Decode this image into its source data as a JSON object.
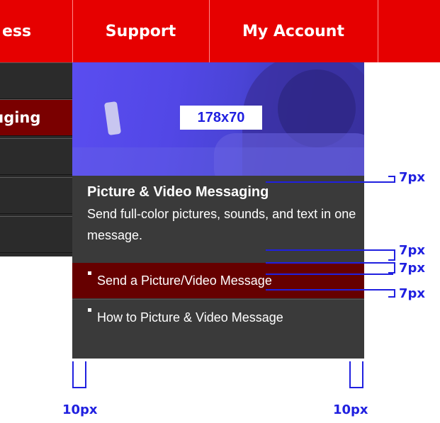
{
  "nav": {
    "items": [
      {
        "label": "ess"
      },
      {
        "label": "Support"
      },
      {
        "label": "My Account"
      }
    ]
  },
  "side_menu": {
    "items": [
      {
        "label": ""
      },
      {
        "label": "ıging",
        "active": true
      },
      {
        "label": ""
      },
      {
        "label": ""
      },
      {
        "label": ""
      }
    ]
  },
  "flyout": {
    "image_placeholder": "178x70",
    "title": "Picture & Video Messaging",
    "description": "Send full-color pictures, sounds, and text in one message.",
    "links": [
      {
        "label": "Send a Picture/Video Message",
        "active": true
      },
      {
        "label": "How to Picture & Video Message"
      }
    ]
  },
  "annotations": {
    "spacing_1": "7px",
    "spacing_2": "7px",
    "spacing_3": "7px",
    "spacing_4": "7px",
    "left_padding": "10px",
    "right_padding": "10px"
  },
  "colors": {
    "nav_red": "#e60000",
    "dark_gray": "#3a3a3a",
    "active_dark_red": "#660000",
    "annotation_blue": "#2020e0"
  }
}
